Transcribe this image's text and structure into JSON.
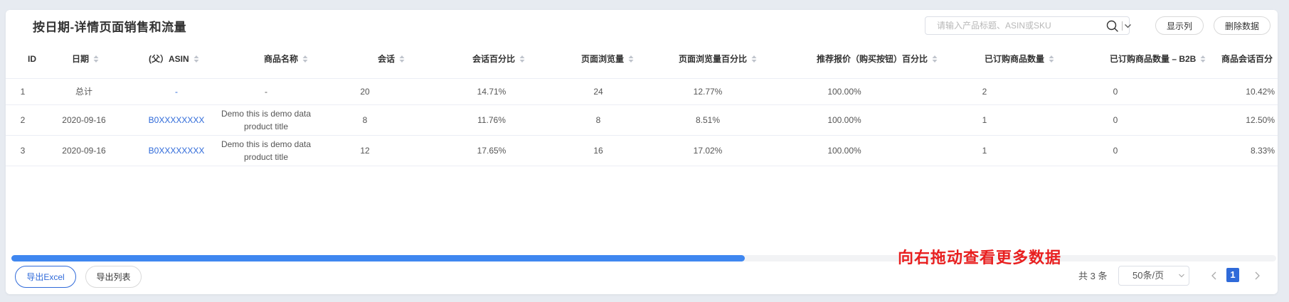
{
  "header": {
    "title": "按日期-详情页面销售和流量",
    "search_placeholder": "请输入产品标题、ASIN或SKU",
    "show_columns_label": "显示列",
    "delete_data_label": "删除数据"
  },
  "table": {
    "columns": [
      {
        "label": "ID",
        "sortable": false
      },
      {
        "label": "日期",
        "sortable": true
      },
      {
        "label": "(父）ASIN",
        "sortable": true
      },
      {
        "label": "商品名称",
        "sortable": true
      },
      {
        "label": "会话",
        "sortable": true
      },
      {
        "label": "会话百分比",
        "sortable": true
      },
      {
        "label": "页面浏览量",
        "sortable": true
      },
      {
        "label": "页面浏览量百分比",
        "sortable": true
      },
      {
        "label": "推荐报价（购买按钮）百分比",
        "sortable": true
      },
      {
        "label": "已订购商品数量",
        "sortable": true
      },
      {
        "label": "已订购商品数量 – B2B",
        "sortable": true
      },
      {
        "label": "商品会话百分",
        "sortable": false
      }
    ],
    "rows": [
      {
        "id": "1",
        "date": "总计",
        "asin": "-",
        "name": "-",
        "sessions": "20",
        "session_pct": "14.71%",
        "page_views": "24",
        "page_view_pct": "12.77%",
        "buybox_pct": "100.00%",
        "units_ordered": "2",
        "units_b2b": "0",
        "unit_session_pct": "10.42%"
      },
      {
        "id": "2",
        "date": "2020-09-16",
        "asin": "B0XXXXXXXX",
        "name": "Demo this is demo data product title",
        "sessions": "8",
        "session_pct": "11.76%",
        "page_views": "8",
        "page_view_pct": "8.51%",
        "buybox_pct": "100.00%",
        "units_ordered": "1",
        "units_b2b": "0",
        "unit_session_pct": "12.50%"
      },
      {
        "id": "3",
        "date": "2020-09-16",
        "asin": "B0XXXXXXXX",
        "name": "Demo this is demo data product title",
        "sessions": "12",
        "session_pct": "17.65%",
        "page_views": "16",
        "page_view_pct": "17.02%",
        "buybox_pct": "100.00%",
        "units_ordered": "1",
        "units_b2b": "0",
        "unit_session_pct": "8.33%"
      }
    ]
  },
  "scrollbar": {
    "horizontal_position_fraction": 0.58
  },
  "hint": {
    "drag_text": "向右拖动查看更多数据"
  },
  "footer": {
    "export_excel_label": "导出Excel",
    "export_list_label": "导出列表",
    "total_text": "共 3 条",
    "page_size_label": "50条/页",
    "current_page": "1"
  },
  "colors": {
    "accent": "#2f6ad9",
    "scroll_thumb": "#3f87f0",
    "hint_red": "#e81f1f"
  },
  "icons": {
    "search": "search-icon",
    "dropdown": "chevron-down-icon",
    "sort": "sort-icon",
    "prev": "chevron-left-icon",
    "next": "chevron-right-icon"
  }
}
